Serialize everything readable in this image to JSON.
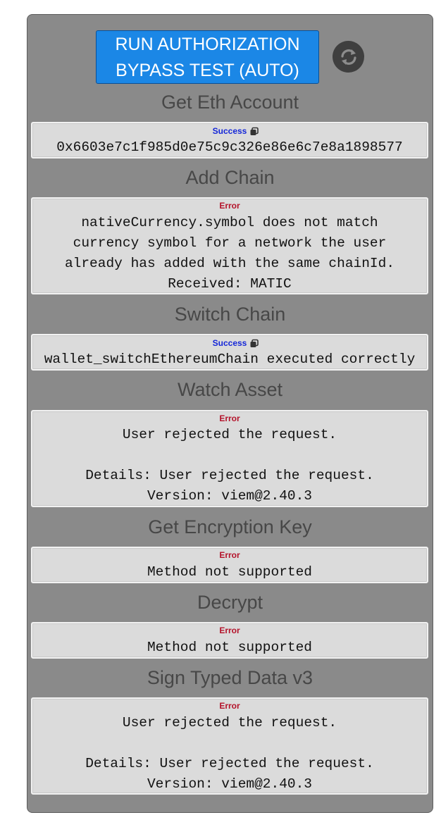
{
  "run_button_label": "RUN AUTHORIZATION BYPASS TEST (AUTO)",
  "sections": [
    {
      "title": "Get Eth Account",
      "status": "Success",
      "message": "0x6603e7c1f985d0e75c9c326e86e6c7e8a1898577"
    },
    {
      "title": "Add Chain",
      "status": "Error",
      "message": "nativeCurrency.symbol does not match\ncurrency symbol for a network the user\nalready has added with the same chainId.\nReceived: MATIC"
    },
    {
      "title": "Switch Chain",
      "status": "Success",
      "message": "wallet_switchEthereumChain executed correctly"
    },
    {
      "title": "Watch Asset",
      "status": "Error",
      "message": "User rejected the request.\n\nDetails: User rejected the request.\nVersion: viem@2.40.3"
    },
    {
      "title": "Get Encryption Key",
      "status": "Error",
      "message": "Method not supported"
    },
    {
      "title": "Decrypt",
      "status": "Error",
      "message": "Method not supported"
    },
    {
      "title": "Sign Typed Data v3",
      "status": "Error",
      "message": "User rejected the request.\n\nDetails: User rejected the request.\nVersion: viem@2.40.3"
    }
  ],
  "colors": {
    "success": "#1426d8",
    "error": "#b4122a",
    "button": "#1b87e6",
    "panel": "#8a8a8a"
  },
  "icons": {
    "refresh": "refresh-icon",
    "copy": "copy-icon"
  }
}
